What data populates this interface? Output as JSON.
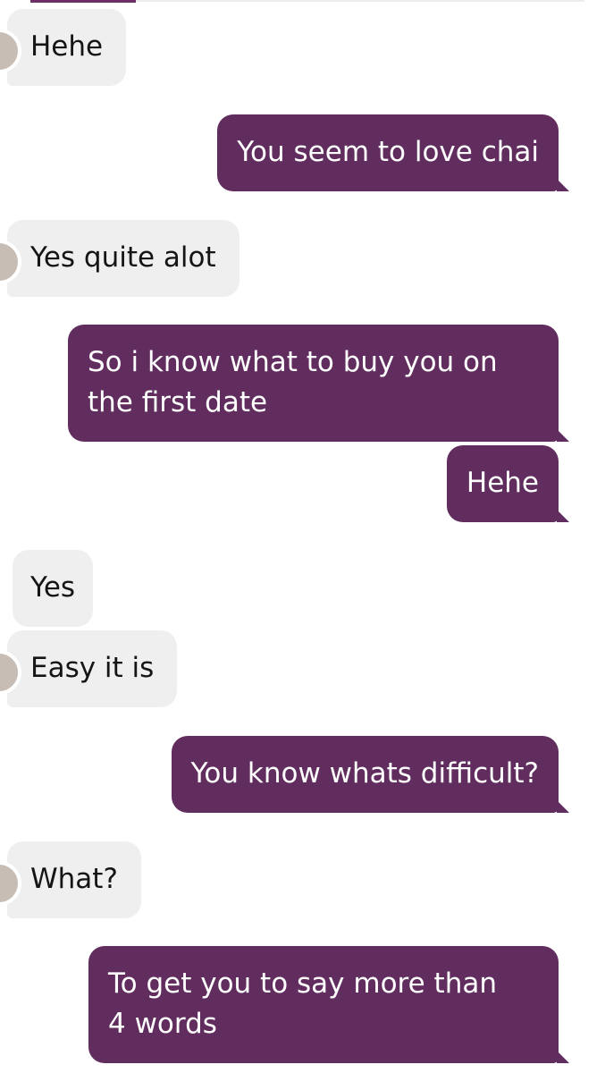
{
  "messages": [
    {
      "side": "in",
      "text": "Hehe",
      "avatar": true
    },
    {
      "side": "out",
      "text": "You seem to love chai"
    },
    {
      "side": "in",
      "text": "Yes quite alot",
      "avatar": true
    },
    {
      "side": "out",
      "text": "So i know what to buy you on the first date",
      "line1": "So i know what to buy you on",
      "line2": "the first date"
    },
    {
      "side": "out",
      "text": "Hehe"
    },
    {
      "side": "in",
      "text": "Yes"
    },
    {
      "side": "in",
      "text": "Easy it is",
      "avatar": true
    },
    {
      "side": "out",
      "text": "You know whats difficult?"
    },
    {
      "side": "in",
      "text": "What?",
      "avatar": true
    },
    {
      "side": "out",
      "text": "To get you to say more than 4 words",
      "line1": "To get you to say more than",
      "line2": "4 words"
    }
  ],
  "colors": {
    "outgoing_bubble": "#612c5e",
    "incoming_bubble": "#efefef",
    "incoming_text": "#151515",
    "outgoing_text": "#ffffff"
  }
}
